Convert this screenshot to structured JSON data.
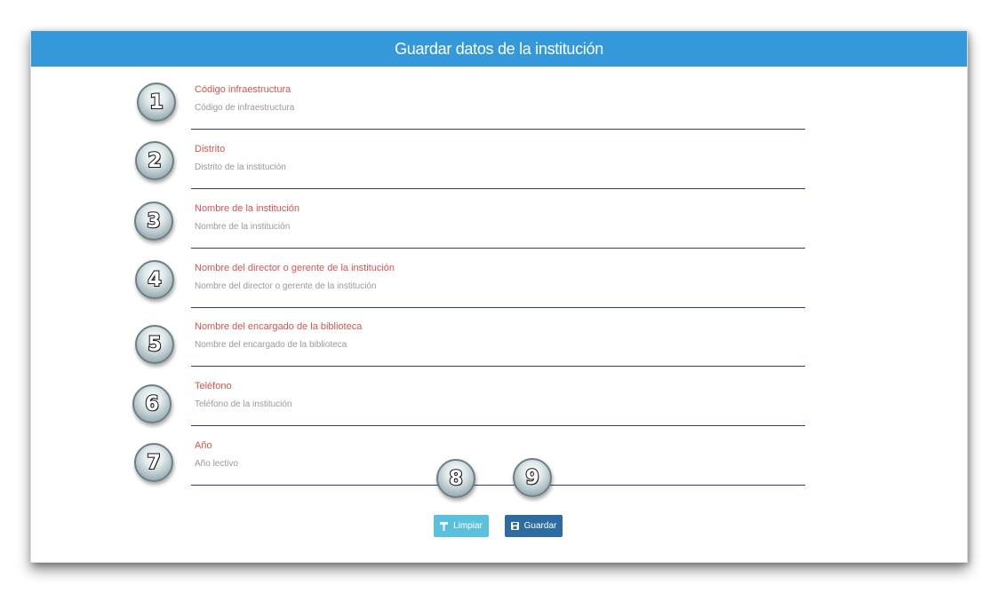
{
  "header": {
    "title": "Guardar datos de la institución"
  },
  "fields": [
    {
      "number": "1",
      "label": "Código infraestructura",
      "placeholder": "Código de infraestructura"
    },
    {
      "number": "2",
      "label": "Distrito",
      "placeholder": "Distrito de la institución"
    },
    {
      "number": "3",
      "label": "Nombre de la institución",
      "placeholder": "Nombre de la institución"
    },
    {
      "number": "4",
      "label": "Nombre del director o gerente de la institución",
      "placeholder": "Nombre del director o gerente de la institución"
    },
    {
      "number": "5",
      "label": "Nombre del encargado de la biblioteca",
      "placeholder": "Nombre del encargado de la biblioteca"
    },
    {
      "number": "6",
      "label": "Teléfono",
      "placeholder": "Teléfono de la institución"
    },
    {
      "number": "7",
      "label": "Año",
      "placeholder": "Año lectivo"
    }
  ],
  "buttons": {
    "limpiar": {
      "number": "8",
      "label": "Limpiar",
      "icon": "paint-roller-icon"
    },
    "guardar": {
      "number": "9",
      "label": "Guardar",
      "icon": "floppy-disk-icon"
    }
  },
  "colors": {
    "header": "#3498db",
    "label": "#d9534f",
    "limpiar": "#5bc0de",
    "guardar": "#2d6ca2",
    "underline": "#2c3e7a"
  }
}
